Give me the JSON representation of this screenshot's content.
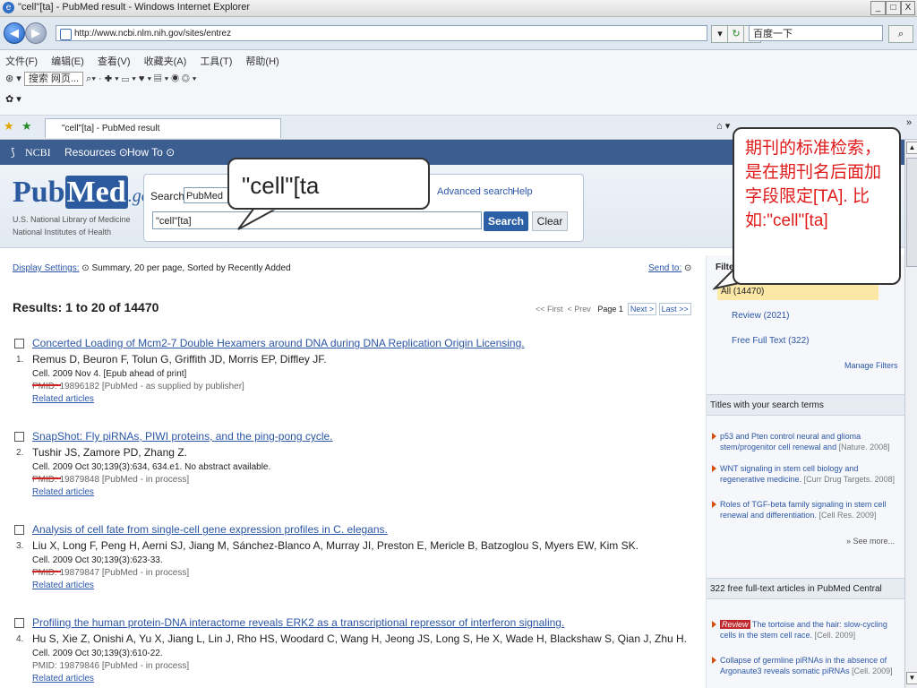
{
  "window": {
    "title": "\"cell\"[ta] - PubMed result - Windows Internet Explorer",
    "min": "_",
    "restore": "□",
    "close": "X"
  },
  "browser": {
    "url": "http://www.ncbi.nlm.nih.gov/sites/entrez",
    "search_placeholder": "百度一下",
    "menu": [
      "文件(F)",
      "编辑(E)",
      "查看(V)",
      "收藏夹(A)",
      "工具(T)",
      "帮助(H)"
    ],
    "toolbar_search": "搜索 网页...",
    "tab_title": "\"cell\"[ta] - PubMed result"
  },
  "ncbi": {
    "brand": "NCBI",
    "resources": "Resources",
    "howto": "How To"
  },
  "pubmed": {
    "logo_pub": "Pub",
    "logo_med": "Med",
    "logo_gov": ".gov",
    "inst1": "U.S. National Library of Medicine",
    "inst2": "National Institutes of Health",
    "search_label": "Search:",
    "db": "PubMed",
    "query": "\"cell\"[ta]",
    "advanced": "Advanced search",
    "help": "Help",
    "search_btn": "Search",
    "clear_btn": "Clear"
  },
  "display": {
    "settings": "Display Settings:",
    "summary": "Summary, 20 per page, Sorted by Recently Added",
    "sendto": "Send to:",
    "results": "Results: 1 to 20 of 14470",
    "first": "<< First",
    "prev": "< Prev",
    "page": "Page 1",
    "next": "Next >",
    "last": "Last >>"
  },
  "results": [
    {
      "title": "Concerted Loading of Mcm2-7 Double Hexamers around DNA during DNA Replication Origin Licensing.",
      "num": "1.",
      "authors": "Remus D, Beuron F, Tolun G, Griffith JD, Morris EP, Diffley JF.",
      "cite": "Cell. 2009 Nov 4. [Epub ahead of print]",
      "pmid": "PMID: 19896182 [PubMed - as supplied by publisher]",
      "related": "Related articles"
    },
    {
      "title": "SnapShot: Fly piRNAs, PIWI proteins, and the ping-pong cycle.",
      "num": "2.",
      "authors": "Tushir JS, Zamore PD, Zhang Z.",
      "cite": "Cell. 2009 Oct 30;139(3):634, 634.e1. No abstract available.",
      "pmid": "PMID: 19879848 [PubMed - in process]",
      "related": "Related articles"
    },
    {
      "title": "Analysis of cell fate from single-cell gene expression profiles in C. elegans.",
      "num": "3.",
      "authors": "Liu X, Long F, Peng H, Aerni SJ, Jiang M, Sánchez-Blanco A, Murray JI, Preston E, Mericle B, Batzoglou S, Myers EW, Kim SK.",
      "cite": "Cell. 2009 Oct 30;139(3):623-33.",
      "pmid": "PMID: 19879847 [PubMed - in process]",
      "related": "Related articles"
    },
    {
      "title": "Profiling the human protein-DNA interactome reveals ERK2 as a transcriptional repressor of interferon signaling.",
      "num": "4.",
      "authors": "Hu S, Xie Z, Onishi A, Yu X, Jiang L, Lin J, Rho HS, Woodard C, Wang H, Jeong JS, Long S, He X, Wade H, Blackshaw S, Qian J, Zhu H.",
      "cite": "Cell. 2009 Oct 30;139(3):610-22.",
      "pmid": "PMID: 19879846 [PubMed - in process]",
      "related": "Related articles"
    }
  ],
  "sidebar": {
    "filter": "Filte",
    "all": "All (14470)",
    "review": "Review (2021)",
    "freefull": "Free Full Text (322)",
    "manage": "Manage Filters",
    "titles_head": "Titles with your search terms",
    "titles": [
      {
        "text": "p53 and Pten control neural and glioma stem/progenitor cell renewal and",
        "src": "[Nature. 2008]"
      },
      {
        "text": "WNT signaling in stem cell biology and regenerative medicine.",
        "src": "[Curr Drug Targets. 2008]"
      },
      {
        "text": "Roles of TGF-beta family signaling in stem cell renewal and differentiation.",
        "src": "[Cell Res. 2009]"
      }
    ],
    "seemore": "» See more...",
    "pmc_head": "322 free full-text articles in PubMed Central",
    "pmc": [
      {
        "badge": "Review",
        "text": "The tortoise and the hair: slow-cycling cells in the stem cell race.",
        "src": "[Cell. 2009]"
      },
      {
        "text": "Collapse of germline piRNAs in the absence of Argonaute3 reveals somatic piRNAs",
        "src": "[Cell. 2009]"
      }
    ]
  },
  "callouts": {
    "query_bubble": "\"cell\"[ta",
    "note": "期刊的标准检索，是在期刊名后面加字段限定[TA]. 比如:\"cell\"[ta]"
  }
}
